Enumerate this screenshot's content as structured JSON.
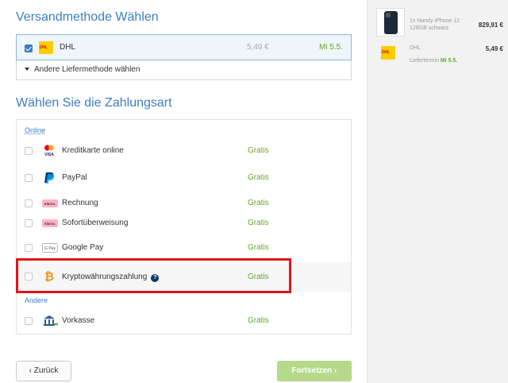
{
  "shipping": {
    "title": "Versandmethode Wählen",
    "selected": {
      "name": "DHL",
      "price": "5,49 €",
      "date": "Mi 5.5."
    },
    "other_label": "Andere Liefermethode wählen"
  },
  "payment": {
    "title": "Wählen Sie die Zahlungsart",
    "groups": {
      "online": "Online",
      "other": "Andere"
    },
    "methods": [
      {
        "name": "Kreditkarte online",
        "cost": "Gratis",
        "icon": "credit-card-icon"
      },
      {
        "name": "PayPal",
        "cost": "Gratis",
        "icon": "paypal-icon"
      },
      {
        "name": "Rechnung",
        "cost": "Gratis",
        "icon": "klarna-icon"
      },
      {
        "name": "Sofortüberweisung",
        "cost": "Gratis",
        "icon": "klarna-icon"
      },
      {
        "name": "Google Pay",
        "cost": "Gratis",
        "icon": "google-pay-icon"
      },
      {
        "name": "Kryptowährungszahlung",
        "cost": "Gratis",
        "icon": "bitcoin-icon"
      },
      {
        "name": "Vorkasse",
        "cost": "Gratis",
        "icon": "bank-transfer-icon"
      }
    ]
  },
  "nav": {
    "back_label": "Zurück",
    "next_label": "Fortsetzen"
  },
  "sidebar": {
    "product_name": "1x Handy iPhone 12 128GB schwarz",
    "product_price": "829,91 €",
    "ship_name": "DHL",
    "ship_price": "5,49 €",
    "ship_date_label": "Liefertermin",
    "ship_date": "Mi 5.5."
  },
  "colors": {
    "accent": "#3b7ec3",
    "green": "#6aa22d",
    "highlight": "#e0141a",
    "dhl_yellow": "#ffcc00"
  }
}
